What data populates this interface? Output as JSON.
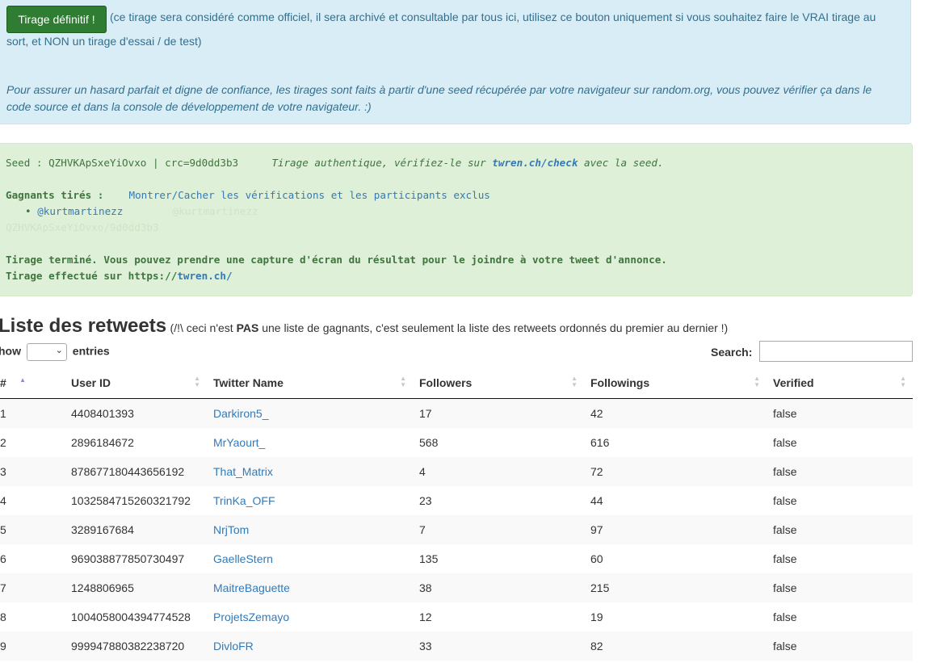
{
  "info": {
    "final_button_label": "Tirage définitif !",
    "line1": "(ce tirage sera considéré comme officiel, il sera archivé et consultable par tous ici, utilisez ce bouton uniquement si vous souhaitez faire le VRAI tirage au",
    "line2": "sort, et NON un tirage d'essai / de test)",
    "line3": "Pour assurer un hasard parfait et digne de confiance, les tirages sont faits à partir d'une seed récupérée par votre navigateur sur random.org, vous pouvez vérifier ça dans le",
    "line4": "code source et dans la console de développement de votre navigateur. :)"
  },
  "result": {
    "seed_text": "Seed : QZHVKApSxeYiOvxo | crc=9d0dd3b3",
    "authentic_prefix": "Tirage authentique, vérifiez-le sur ",
    "check_link": "twren.ch/check",
    "authentic_suffix": " avec la seed.",
    "winners_label": "Gagnants tirés :",
    "toggle_link": "Montrer/Cacher les vérifications et les participants exclus",
    "winner": "@kurtmartinezz",
    "winner_faint": "@kurtmartinezz",
    "seed_faint": "QZHVKApSxeYiOvxo/9d0dd3b3",
    "done_text": "Tirage terminé. Vous pouvez prendre une capture d'écran du résultat pour le joindre à votre tweet d'annonce.",
    "performed_prefix": "Tirage effectué sur https://",
    "performed_link": "twren.ch/"
  },
  "list": {
    "title": "Liste des retweets",
    "note_prefix": "(/!\\ ceci n'est ",
    "note_bold": "PAS",
    "note_suffix": " une liste de gagnants, c'est seulement la liste des retweets ordonnés du premier au dernier !)",
    "show_label": "how",
    "entries_label": "entries",
    "search_label": "Search:",
    "search_value": ""
  },
  "table": {
    "headers": [
      "#",
      "User ID",
      "Twitter Name",
      "Followers",
      "Followings",
      "Verified"
    ],
    "rows": [
      [
        "1",
        "4408401393",
        "Darkiron5_",
        "17",
        "42",
        "false"
      ],
      [
        "2",
        "2896184672",
        "MrYaourt_",
        "568",
        "616",
        "false"
      ],
      [
        "3",
        "878677180443656192",
        "That_Matrix",
        "4",
        "72",
        "false"
      ],
      [
        "4",
        "1032584715260321792",
        "TrinKa_OFF",
        "23",
        "44",
        "false"
      ],
      [
        "5",
        "3289167684",
        "NrjTom",
        "7",
        "97",
        "false"
      ],
      [
        "6",
        "969038877850730497",
        "GaelleStern",
        "135",
        "60",
        "false"
      ],
      [
        "7",
        "1248806965",
        "MaitreBaguette",
        "38",
        "215",
        "false"
      ],
      [
        "8",
        "1004058004394774528",
        "ProjetsZemayo",
        "12",
        "19",
        "false"
      ],
      [
        "9",
        "999947880382238720",
        "DivloFR",
        "33",
        "82",
        "false"
      ]
    ]
  },
  "colors": {
    "button_green": "#2e7d32",
    "info_bg": "#d9edf7",
    "success_bg": "#dff0d8",
    "link": "#337ab7"
  }
}
